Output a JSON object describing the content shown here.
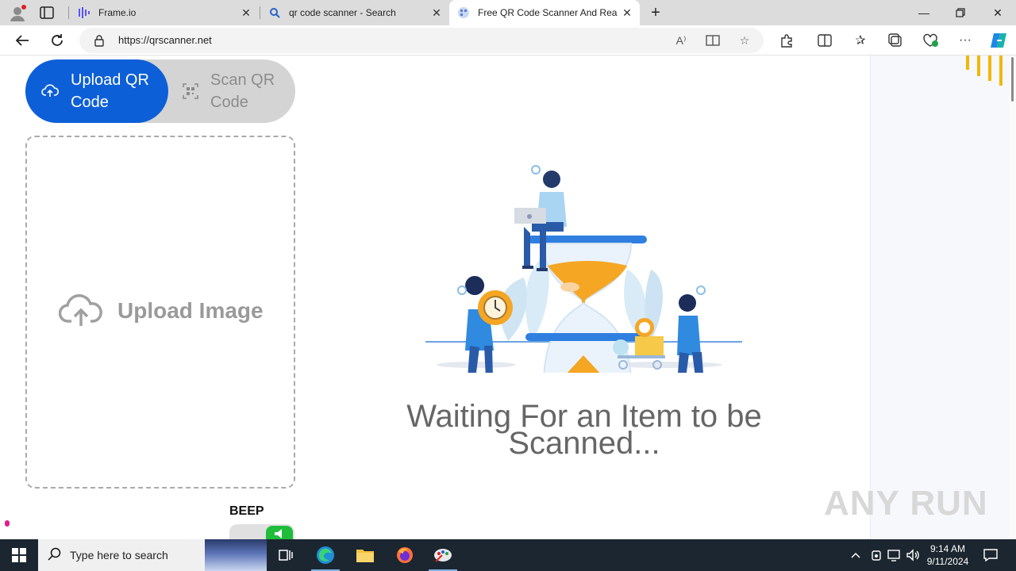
{
  "browser": {
    "tabs": [
      {
        "label": "Frame.io",
        "icon": "frameio-icon"
      },
      {
        "label": "qr code scanner - Search",
        "icon": "search-icon"
      },
      {
        "label": "Free QR Code Scanner And Read",
        "icon": "qrscanner-favicon",
        "active": true
      }
    ],
    "url": "https://qrscanner.net"
  },
  "page": {
    "upload_label": "Upload QR Code",
    "scan_label": "Scan QR Code",
    "upload_image_label": "Upload Image",
    "beep_label": "BEEP",
    "waiting_text": "Waiting For an Item to be Scanned...",
    "watermark": "ANY RUN"
  },
  "taskbar": {
    "search_placeholder": "Type here to search",
    "time": "9:14 AM",
    "date": "9/11/2024"
  },
  "colors": {
    "accent_blue": "#0d5fd8",
    "beep_green": "#1ebd3a",
    "hourglass_orange": "#f5a623"
  }
}
